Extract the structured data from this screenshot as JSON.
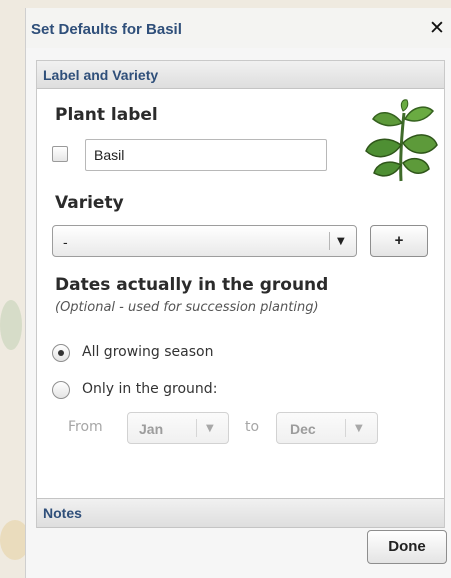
{
  "dialog": {
    "title": "Set Defaults for Basil",
    "close_icon": "close-icon"
  },
  "sections": {
    "label_and_variety": "Label and Variety",
    "notes": "Notes"
  },
  "plant_label": {
    "heading": "Plant label",
    "value": "Basil",
    "checked": false,
    "illustration_icon": "basil-plant-icon"
  },
  "variety": {
    "heading": "Variety",
    "selected": "-",
    "add_label": "+"
  },
  "dates": {
    "heading": "Dates actually in the ground",
    "note": "(Optional - used for succession planting)",
    "option_all": "All growing season",
    "option_only": "Only in the ground:",
    "selected_option": "all",
    "from_label": "From",
    "from_value": "Jan",
    "to_label": "to",
    "to_value": "Dec"
  },
  "footer": {
    "done_label": "Done"
  }
}
